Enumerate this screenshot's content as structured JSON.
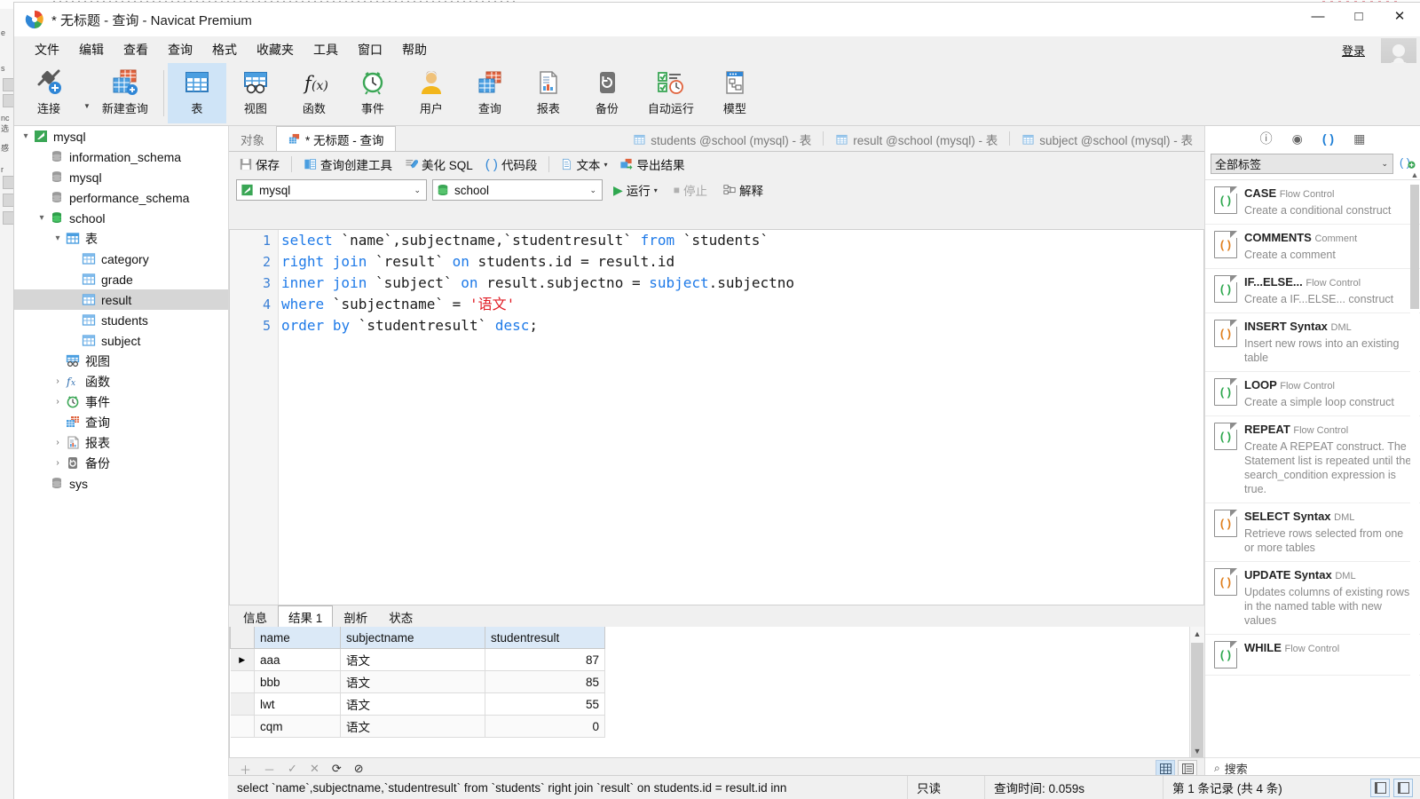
{
  "window": {
    "title": "* 无标题 - 查询 - Navicat Premium",
    "minimize": "—",
    "maximize": "□",
    "close": "✕"
  },
  "menubar": {
    "items": [
      "文件",
      "编辑",
      "查看",
      "查询",
      "格式",
      "收藏夹",
      "工具",
      "窗口",
      "帮助"
    ],
    "login": "登录"
  },
  "ribbon": {
    "items": [
      {
        "label": "连接",
        "icon": "connection-icon"
      },
      {
        "label": "新建查询",
        "icon": "new-query-icon"
      },
      {
        "label": "表",
        "icon": "table-icon",
        "active": true
      },
      {
        "label": "视图",
        "icon": "view-icon"
      },
      {
        "label": "函数",
        "icon": "function-icon"
      },
      {
        "label": "事件",
        "icon": "event-icon"
      },
      {
        "label": "用户",
        "icon": "user-icon"
      },
      {
        "label": "查询",
        "icon": "query-icon"
      },
      {
        "label": "报表",
        "icon": "report-icon"
      },
      {
        "label": "备份",
        "icon": "backup-icon"
      },
      {
        "label": "自动运行",
        "icon": "automation-icon"
      },
      {
        "label": "模型",
        "icon": "model-icon"
      }
    ]
  },
  "tree": {
    "nodes": [
      {
        "label": "mysql",
        "depth": 0,
        "arrow": "▾",
        "icon": "connection-icon"
      },
      {
        "label": "information_schema",
        "depth": 1,
        "arrow": "",
        "icon": "database-icon"
      },
      {
        "label": "mysql",
        "depth": 1,
        "arrow": "",
        "icon": "database-icon"
      },
      {
        "label": "performance_schema",
        "depth": 1,
        "arrow": "",
        "icon": "database-icon"
      },
      {
        "label": "school",
        "depth": 1,
        "arrow": "▾",
        "icon": "database-open-icon"
      },
      {
        "label": "表",
        "depth": 2,
        "arrow": "▾",
        "icon": "tables-folder-icon"
      },
      {
        "label": "category",
        "depth": 3,
        "arrow": "",
        "icon": "table-icon"
      },
      {
        "label": "grade",
        "depth": 3,
        "arrow": "",
        "icon": "table-icon"
      },
      {
        "label": "result",
        "depth": 3,
        "arrow": "",
        "icon": "table-icon",
        "selected": true
      },
      {
        "label": "students",
        "depth": 3,
        "arrow": "",
        "icon": "table-icon"
      },
      {
        "label": "subject",
        "depth": 3,
        "arrow": "",
        "icon": "table-icon"
      },
      {
        "label": "视图",
        "depth": 2,
        "arrow": "",
        "icon": "view-icon"
      },
      {
        "label": "函数",
        "depth": 2,
        "arrow": "›",
        "icon": "function-icon"
      },
      {
        "label": "事件",
        "depth": 2,
        "arrow": "›",
        "icon": "event-icon"
      },
      {
        "label": "查询",
        "depth": 2,
        "arrow": "",
        "icon": "query-icon"
      },
      {
        "label": "报表",
        "depth": 2,
        "arrow": "›",
        "icon": "report-icon"
      },
      {
        "label": "备份",
        "depth": 2,
        "arrow": "›",
        "icon": "backup-icon"
      },
      {
        "label": "sys",
        "depth": 1,
        "arrow": "",
        "icon": "database-icon"
      }
    ]
  },
  "doc_tabs": [
    {
      "label": "对象",
      "icon": "",
      "active": false
    },
    {
      "label": "* 无标题 - 查询",
      "icon": "query-icon",
      "active": true
    },
    {
      "label": "students @school (mysql) - 表",
      "icon": "table-icon",
      "active": false
    },
    {
      "label": "result @school (mysql) - 表",
      "icon": "table-icon",
      "active": false
    },
    {
      "label": "subject @school (mysql) - 表",
      "icon": "table-icon",
      "active": false
    }
  ],
  "editor_toolbar": {
    "save": "保存",
    "query_builder": "查询创建工具",
    "beautify_sql": "美化 SQL",
    "code_snippet": "代码段",
    "text": "文本",
    "export_result": "导出结果"
  },
  "editor_toolbar2": {
    "connection": "mysql",
    "database": "school",
    "run": "运行",
    "stop": "停止",
    "explain": "解释"
  },
  "sql": {
    "line_numbers": [
      "1",
      "2",
      "3",
      "4",
      "5"
    ],
    "lines": [
      [
        {
          "t": "select",
          "c": "kw"
        },
        {
          "t": " `name`,subjectname,`studentresult` ",
          "c": "pl"
        },
        {
          "t": "from",
          "c": "kw"
        },
        {
          "t": " `students`",
          "c": "pl"
        }
      ],
      [
        {
          "t": "right join",
          "c": "kw"
        },
        {
          "t": " `result` ",
          "c": "pl"
        },
        {
          "t": "on",
          "c": "kw"
        },
        {
          "t": " students.id = result.id",
          "c": "pl"
        }
      ],
      [
        {
          "t": "inner join",
          "c": "kw"
        },
        {
          "t": " `subject` ",
          "c": "pl"
        },
        {
          "t": "on",
          "c": "kw"
        },
        {
          "t": " result.subjectno = ",
          "c": "pl"
        },
        {
          "t": "subject",
          "c": "kw"
        },
        {
          "t": ".subjectno",
          "c": "pl"
        }
      ],
      [
        {
          "t": "where",
          "c": "kw"
        },
        {
          "t": " `subjectname` = ",
          "c": "pl"
        },
        {
          "t": "'语文'",
          "c": "str"
        }
      ],
      [
        {
          "t": "order",
          "c": "kw"
        },
        {
          "t": " ",
          "c": "pl"
        },
        {
          "t": "by",
          "c": "kw"
        },
        {
          "t": " `studentresult` ",
          "c": "pl"
        },
        {
          "t": "desc",
          "c": "kw"
        },
        {
          "t": ";",
          "c": "pl"
        }
      ]
    ],
    "plain": "select `name`,subjectname,`studentresult` from `students`\nright join `result` on students.id = result.id\ninner join `subject` on result.subjectno = subject.subjectno\nwhere `subjectname` = '语文'\norder by `studentresult` desc;"
  },
  "result_tabs": [
    {
      "label": "信息",
      "active": false
    },
    {
      "label": "结果 1",
      "active": true
    },
    {
      "label": "剖析",
      "active": false
    },
    {
      "label": "状态",
      "active": false
    }
  ],
  "grid": {
    "columns": [
      "name",
      "subjectname",
      "studentresult"
    ],
    "rows": [
      {
        "marker": "▶",
        "name": "aaa",
        "subjectname": "语文",
        "studentresult": "87"
      },
      {
        "marker": "",
        "name": "bbb",
        "subjectname": "语文",
        "studentresult": "85"
      },
      {
        "marker": "",
        "name": "lwt",
        "subjectname": "语文",
        "studentresult": "55"
      },
      {
        "marker": "",
        "name": "cqm",
        "subjectname": "语文",
        "studentresult": "0"
      }
    ]
  },
  "row_toolbar": {
    "add": "＋",
    "remove": "－",
    "confirm": "✓",
    "cancel": "✕",
    "refresh": "⟳",
    "stop": "⊘"
  },
  "statusbar": {
    "sql": "select `name`,subjectname,`studentresult` from `students` right join `result` on students.id = result.id inn",
    "readonly": "只读",
    "query_time": "查询时间: 0.059s",
    "record_info": "第 1 条记录 (共 4 条)"
  },
  "snippets": {
    "tabs": [
      {
        "icon": "info-icon",
        "label": "ⓘ",
        "active": false
      },
      {
        "icon": "preview-icon",
        "label": "◉",
        "active": false
      },
      {
        "icon": "code-snippet-icon",
        "label": "( )",
        "active": true
      },
      {
        "icon": "structure-icon",
        "label": "▦",
        "active": false
      }
    ],
    "filter_value": "全部标签",
    "search_placeholder": "搜索",
    "items": [
      {
        "name": "CASE",
        "category": "Flow Control",
        "desc": "Create a conditional construct",
        "accent": "#2fa84f"
      },
      {
        "name": "COMMENTS",
        "category": "Comment",
        "desc": "Create a comment",
        "accent": "#e08020"
      },
      {
        "name": "IF...ELSE...",
        "category": "Flow Control",
        "desc": "Create a IF...ELSE... construct",
        "accent": "#2fa84f"
      },
      {
        "name": "INSERT Syntax",
        "category": "DML",
        "desc": "Insert new rows into an existing table",
        "accent": "#e08020"
      },
      {
        "name": "LOOP",
        "category": "Flow Control",
        "desc": "Create a simple loop construct",
        "accent": "#2fa84f"
      },
      {
        "name": "REPEAT",
        "category": "Flow Control",
        "desc": "Create A REPEAT construct. The Statement list is repeated until the search_condition expression is true.",
        "accent": "#2fa84f"
      },
      {
        "name": "SELECT Syntax",
        "category": "DML",
        "desc": "Retrieve rows selected from one or more tables",
        "accent": "#e08020"
      },
      {
        "name": "UPDATE Syntax",
        "category": "DML",
        "desc": "Updates columns of existing rows in the named table with new values",
        "accent": "#e08020"
      },
      {
        "name": "WHILE",
        "category": "Flow Control",
        "desc": "",
        "accent": "#2fa84f"
      }
    ]
  },
  "colors": {
    "accent_blue": "#1e7ae8",
    "string_red": "#e01b24",
    "tab_active": "#cfe4f7",
    "header_blue": "#dbe9f7",
    "run_green": "#2fa84f"
  }
}
